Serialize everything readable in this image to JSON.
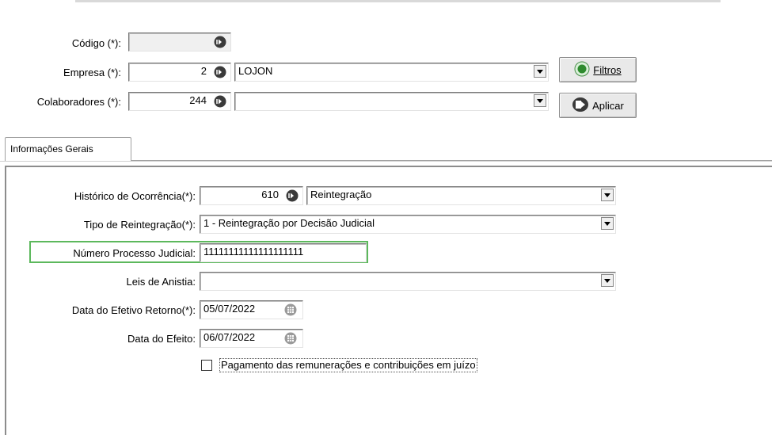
{
  "header": {
    "codigo": {
      "label": "Código (*):",
      "value": ""
    },
    "empresa": {
      "label": "Empresa (*):",
      "code": "2",
      "name": "LOJON"
    },
    "colaboradores": {
      "label": "Colaboradores (*):",
      "code": "244",
      "name": ""
    },
    "filtros_label": "Filtros",
    "aplicar_label": "Aplicar"
  },
  "tabs": [
    {
      "label": "Informações Gerais"
    }
  ],
  "form": {
    "historico": {
      "label": "Histórico de Ocorrência(*):",
      "code": "610",
      "name": "Reintegração"
    },
    "tipo": {
      "label": "Tipo de Reintegração(*):",
      "value": "1 - Reintegração por Decisão Judicial"
    },
    "numero": {
      "label": "Número Processo Judicial:",
      "value": "11111111111111111111"
    },
    "leis": {
      "label": "Leis de Anistia:",
      "value": ""
    },
    "data_retorno": {
      "label": "Data do Efetivo Retorno(*):",
      "value": "05/07/2022"
    },
    "data_efeito": {
      "label": "Data do Efeito:",
      "value": "06/07/2022"
    },
    "pagamento": {
      "label": "Pagamento das remunerações e contribuições em juízo",
      "checked": false
    }
  },
  "colors": {
    "highlight": "#5cb85c",
    "icon_green": "#2e8b2e"
  }
}
